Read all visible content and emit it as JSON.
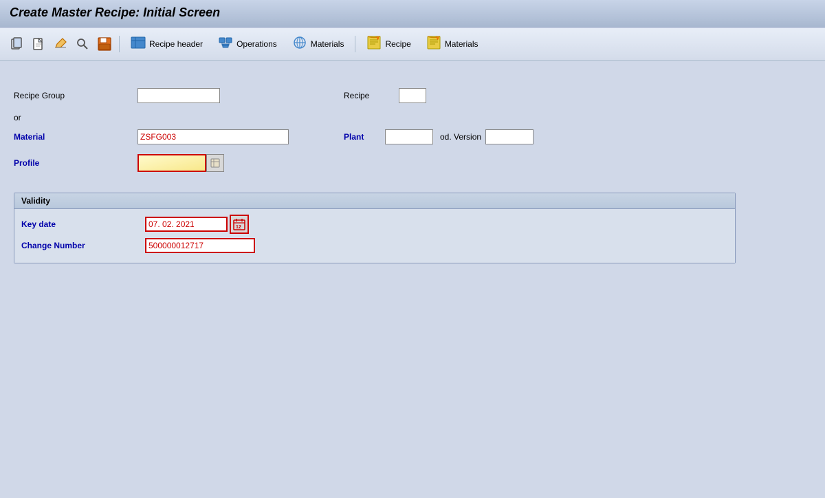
{
  "page": {
    "title": "Create Master Recipe: Initial Screen"
  },
  "toolbar": {
    "buttons": [
      {
        "name": "copy-icon",
        "symbol": "⧉",
        "label": "Copy"
      },
      {
        "name": "new-icon",
        "symbol": "📄",
        "label": "New"
      },
      {
        "name": "edit-icon",
        "symbol": "✏️",
        "label": "Edit"
      },
      {
        "name": "find-icon",
        "symbol": "🔍",
        "label": "Find"
      },
      {
        "name": "save-icon",
        "symbol": "💾",
        "label": "Save"
      }
    ],
    "menu_items": [
      {
        "name": "recipe-header",
        "label": "Recipe header"
      },
      {
        "name": "operations",
        "label": "Operations"
      },
      {
        "name": "materials-menu",
        "label": "Materials"
      },
      {
        "name": "recipe-menu",
        "label": "Recipe"
      },
      {
        "name": "materials-right",
        "label": "Materials"
      }
    ]
  },
  "form": {
    "recipe_group_label": "Recipe Group",
    "recipe_group_value": "",
    "recipe_label": "Recipe",
    "recipe_value": "",
    "or_text": "or",
    "material_label": "Material",
    "material_value": "ZSFG003",
    "plant_label": "Plant",
    "plant_value": "",
    "prod_version_label": "od. Version",
    "prod_version_value": "",
    "profile_label": "Profile",
    "profile_value": ""
  },
  "validity": {
    "section_title": "Validity",
    "key_date_label": "Key date",
    "key_date_value": "07. 02. 2021",
    "change_number_label": "Change Number",
    "change_number_value": "500000012717"
  }
}
